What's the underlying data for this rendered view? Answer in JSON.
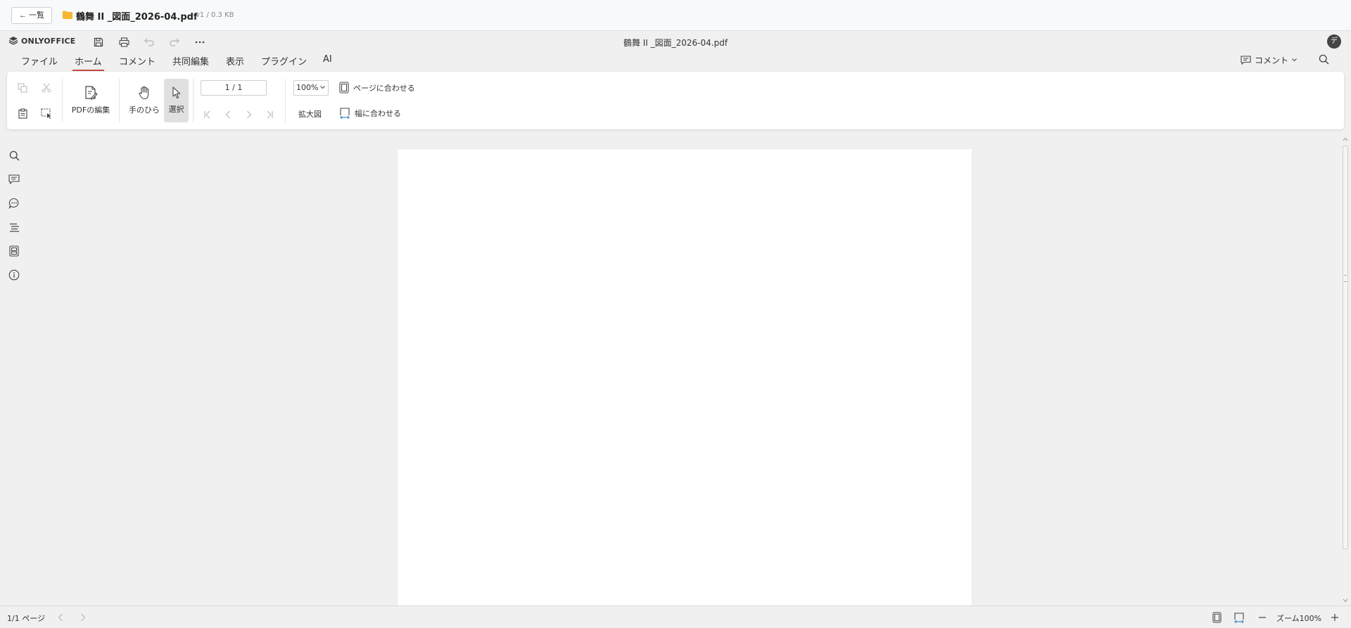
{
  "topbar": {
    "back_label": "← 一覧",
    "file_title": "鶴舞 II _図面_2026-04.pdf",
    "file_meta": "v1 / 0.3 KB",
    "folder_icon": "folder-icon",
    "folder_color": "#f5b731"
  },
  "header": {
    "logo_text": "ONLYOFFICE",
    "doc_title": "鶴舞 II _図面_2026-04.pdf",
    "avatar_initial": "デ",
    "tabs": [
      {
        "label": "ファイル"
      },
      {
        "label": "ホーム",
        "active": true
      },
      {
        "label": "コメント"
      },
      {
        "label": "共同編集"
      },
      {
        "label": "表示"
      },
      {
        "label": "プラグイン"
      },
      {
        "label": "AI"
      }
    ],
    "comment_menu_label": "コメント",
    "accent_color": "#c24a3f"
  },
  "toolbar": {
    "edit_pdf_label": "PDFの編集",
    "hand_label": "手のひら",
    "select_label": "選択",
    "page_value": "1 / 1",
    "zoom_value": "100%",
    "zoom_in_label": "拡大図",
    "fit_page_label": "ページに合わせる",
    "fit_width_label": "幅に合わせる"
  },
  "statusbar": {
    "page_count": "1/1 ページ",
    "zoom_label": "ズーム100%"
  }
}
